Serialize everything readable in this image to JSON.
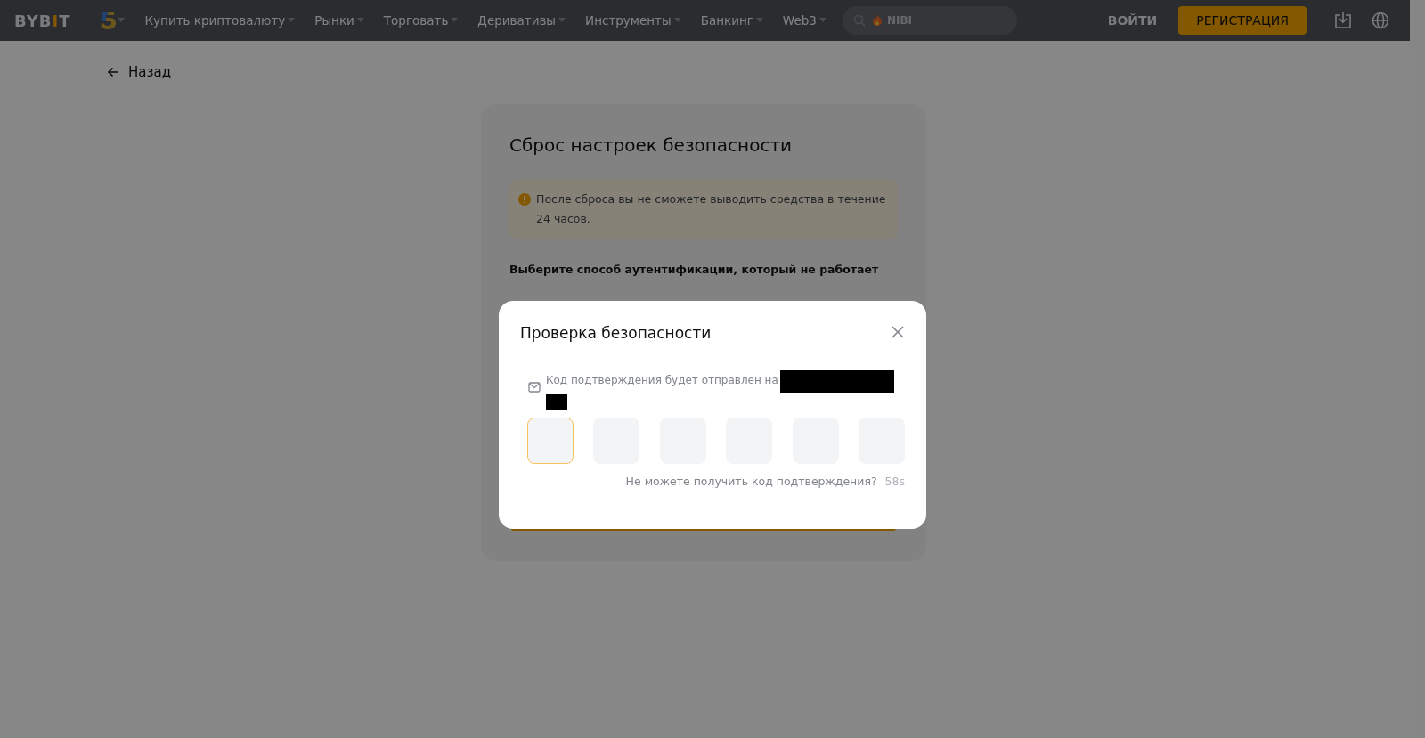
{
  "header": {
    "logo": [
      {
        "text": "BYB",
        "accent": false
      },
      {
        "text": "I",
        "accent": true
      },
      {
        "text": "T",
        "accent": false
      }
    ],
    "nav": [
      {
        "label": "Купить криптовалюту"
      },
      {
        "label": "Рынки"
      },
      {
        "label": "Торговать"
      },
      {
        "label": "Деривативы"
      },
      {
        "label": "Инструменты"
      },
      {
        "label": "Банкинг"
      },
      {
        "label": "Web3"
      }
    ],
    "search": {
      "placeholder": "NIBI"
    },
    "login": "ВОЙТИ",
    "register": "РЕГИСТРАЦИЯ"
  },
  "back": "Назад",
  "card": {
    "title": "Сброс настроек безопасности",
    "warning": "После сброса вы не сможете выводить средства в течение 24 часов.",
    "prompt": "Выберите способ аутентификации, который не работает"
  },
  "modal": {
    "title": "Проверка безопасности",
    "message": "Код подтверждения будет отправлен на",
    "code_boxes": [
      {
        "focused": true
      },
      {
        "focused": false
      },
      {
        "focused": false
      },
      {
        "focused": false
      },
      {
        "focused": false
      },
      {
        "focused": false
      }
    ],
    "help": "Не можете получить код подтверждения?",
    "timer": "58s"
  }
}
